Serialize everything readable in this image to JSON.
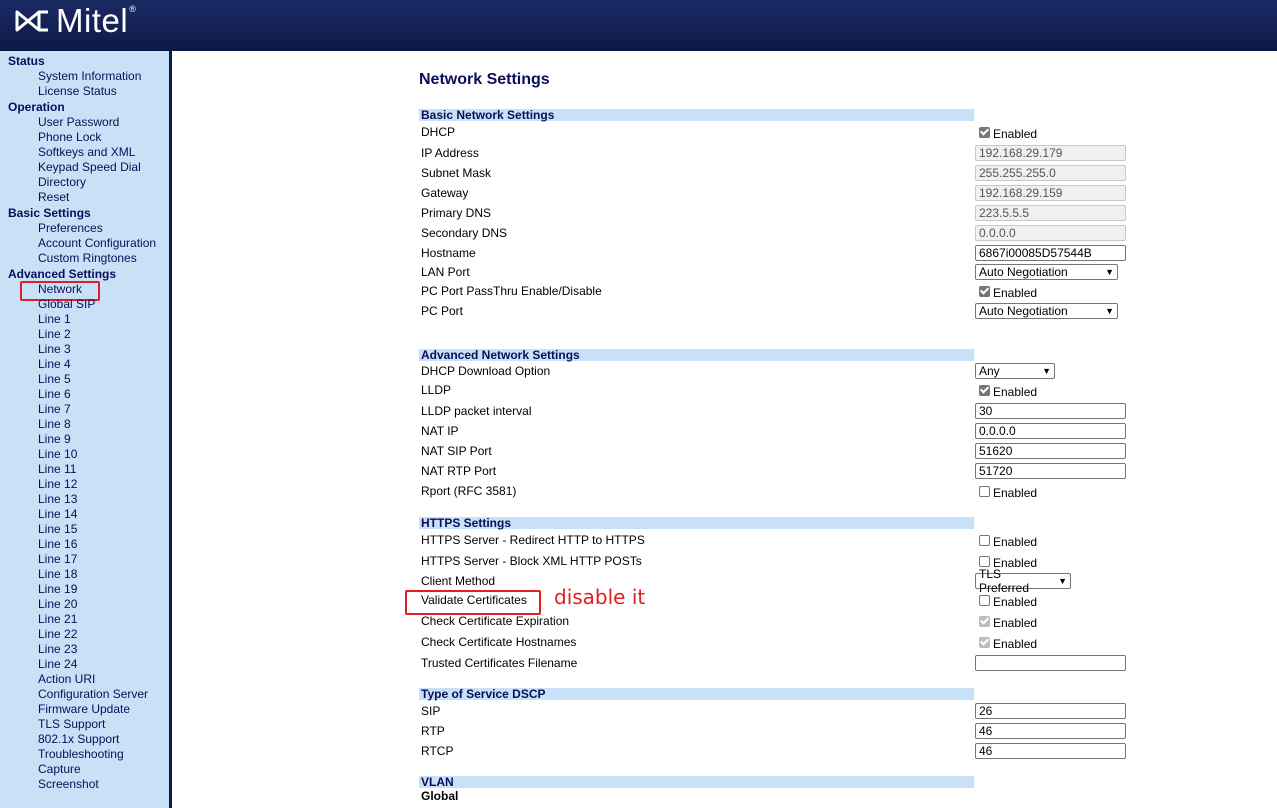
{
  "header": {
    "brand": "Mitel",
    "tm": "®"
  },
  "sidebar": {
    "status": "Status",
    "system_information": "System Information",
    "license_status": "License Status",
    "operation": "Operation",
    "user_password": "User Password",
    "phone_lock": "Phone Lock",
    "softkeys_xml": "Softkeys and XML",
    "keypad_speed_dial": "Keypad Speed Dial",
    "directory": "Directory",
    "reset": "Reset",
    "basic_settings": "Basic Settings",
    "preferences": "Preferences",
    "account_configuration": "Account Configuration",
    "custom_ringtones": "Custom Ringtones",
    "advanced_settings": "Advanced Settings",
    "network": "Network",
    "global_sip": "Global SIP",
    "lines": [
      "Line 1",
      "Line 2",
      "Line 3",
      "Line 4",
      "Line 5",
      "Line 6",
      "Line 7",
      "Line 8",
      "Line 9",
      "Line 10",
      "Line 11",
      "Line 12",
      "Line 13",
      "Line 14",
      "Line 15",
      "Line 16",
      "Line 17",
      "Line 18",
      "Line 19",
      "Line 20",
      "Line 21",
      "Line 22",
      "Line 23",
      "Line 24"
    ],
    "action_uri": "Action URI",
    "configuration_server": "Configuration Server",
    "firmware_update": "Firmware Update",
    "tls_support": "TLS Support",
    "dot1x_support": "802.1x Support",
    "troubleshooting": "Troubleshooting",
    "capture": "Capture",
    "screenshot": "Screenshot"
  },
  "page": {
    "title": "Network Settings"
  },
  "enabled_label": "Enabled",
  "basic": {
    "header": "Basic Network Settings",
    "dhcp": "DHCP",
    "ip_address": "IP Address",
    "ip_address_value": "192.168.29.179",
    "subnet_mask": "Subnet Mask",
    "subnet_mask_value": "255.255.255.0",
    "gateway": "Gateway",
    "gateway_value": "192.168.29.159",
    "primary_dns": "Primary DNS",
    "primary_dns_value": "223.5.5.5",
    "secondary_dns": "Secondary DNS",
    "secondary_dns_value": "0.0.0.0",
    "hostname": "Hostname",
    "hostname_value": "6867i00085D57544B",
    "lan_port": "LAN Port",
    "lan_port_value": "Auto Negotiation",
    "pc_passthru": "PC Port PassThru Enable/Disable",
    "pc_port": "PC Port",
    "pc_port_value": "Auto Negotiation"
  },
  "advanced": {
    "header": "Advanced Network Settings",
    "dhcp_download_option": "DHCP Download Option",
    "dhcp_download_option_value": "Any",
    "lldp": "LLDP",
    "lldp_interval": "LLDP packet interval",
    "lldp_interval_value": "30",
    "nat_ip": "NAT IP",
    "nat_ip_value": "0.0.0.0",
    "nat_sip_port": "NAT SIP Port",
    "nat_sip_port_value": "51620",
    "nat_rtp_port": "NAT RTP Port",
    "nat_rtp_port_value": "51720",
    "rport": "Rport (RFC 3581)"
  },
  "https": {
    "header": "HTTPS Settings",
    "redirect": "HTTPS Server - Redirect HTTP to HTTPS",
    "block_xml": "HTTPS Server - Block XML HTTP POSTs",
    "client_method": "Client Method",
    "client_method_value": "TLS Preferred",
    "validate_certificates": "Validate Certificates",
    "check_expiration": "Check Certificate Expiration",
    "check_hostnames": "Check Certificate Hostnames",
    "trusted_filename": "Trusted Certificates Filename",
    "trusted_filename_value": ""
  },
  "tos": {
    "header": "Type of Service DSCP",
    "sip": "SIP",
    "sip_value": "26",
    "rtp": "RTP",
    "rtp_value": "46",
    "rtcp": "RTCP",
    "rtcp_value": "46"
  },
  "vlan": {
    "header": "VLAN",
    "global": "Global"
  },
  "annotation": "disable it",
  "colors": {
    "header_bg": "#13245a",
    "sidebar_bg": "#c9e1f7",
    "highlight": "#e02020",
    "nav_text": "#0a0e5a"
  }
}
